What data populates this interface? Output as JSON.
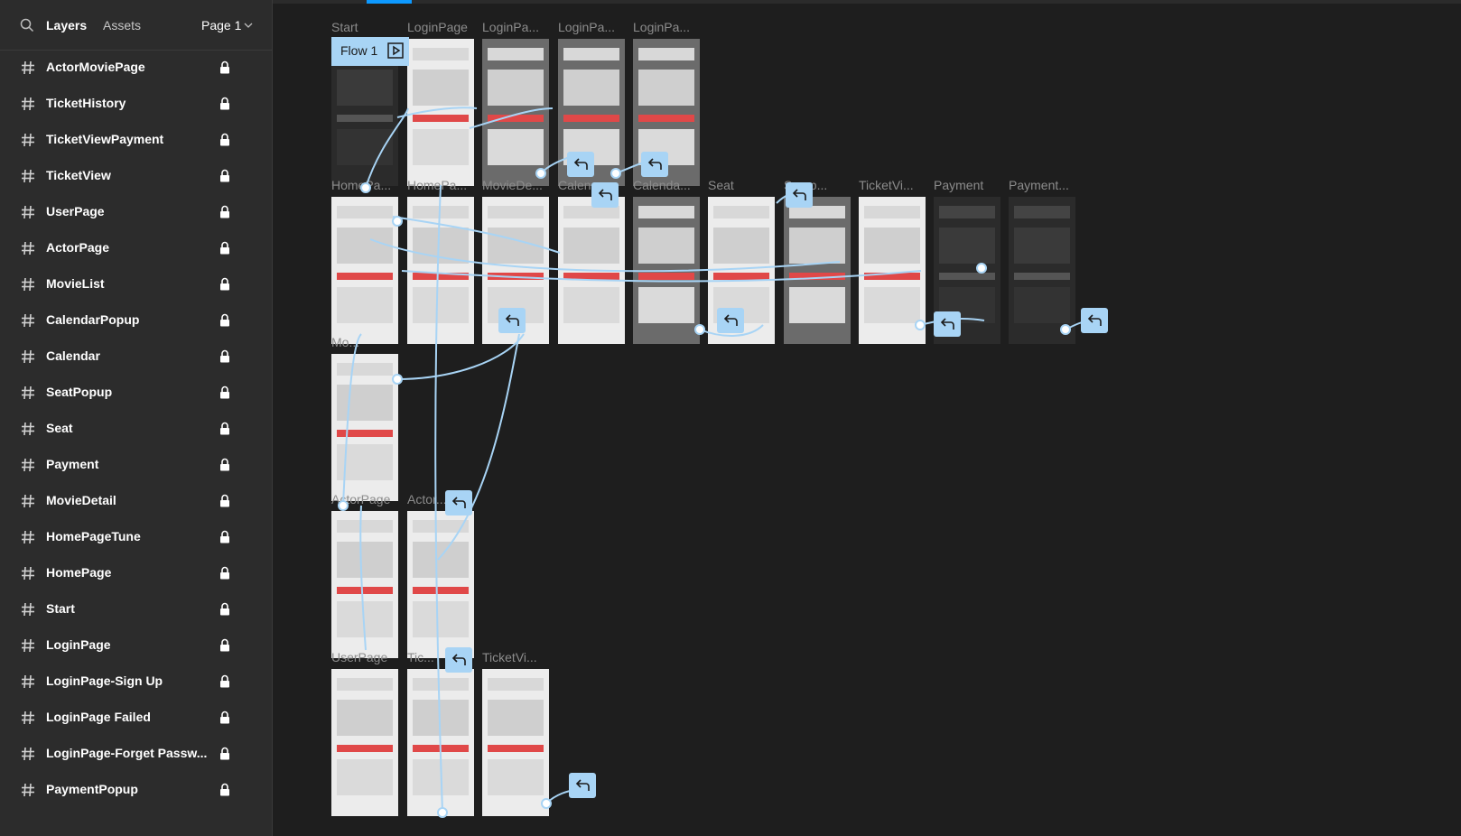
{
  "sidebar": {
    "tabs": {
      "layers": "Layers",
      "assets": "Assets"
    },
    "page_selector": "Page 1",
    "layers": [
      "ActorMoviePage",
      "TicketHistory",
      "TicketViewPayment",
      "TicketView",
      "UserPage",
      "ActorPage",
      "MovieList",
      "CalendarPopup",
      "Calendar",
      "SeatPopup",
      "Seat",
      "Payment",
      "MovieDetail",
      "HomePageTune",
      "HomePage",
      "Start",
      "LoginPage",
      "LoginPage-Sign Up",
      "LoginPage Failed",
      "LoginPage-Forget Passw...",
      "PaymentPopup"
    ]
  },
  "canvas": {
    "flow_badge": "Flow 1",
    "frame_labels": {
      "start": "Start",
      "login1": "LoginPage",
      "login2": "LoginPa...",
      "login3": "LoginPa...",
      "login4": "LoginPa...",
      "homepage": "HomePa...",
      "homepage2": "HomePa...",
      "moviedetail": "MovieDe...",
      "calendar": "Calen...",
      "calendar2": "Calenda...",
      "seat": "Seat",
      "seatpopup": "Se...p...",
      "ticketview": "TicketVi...",
      "payment": "Payment",
      "payment2": "Payment...",
      "movielist": "Mo...",
      "actorpage": "ActorPage",
      "actormovie": "Actor...",
      "userpage": "UserPage",
      "tickethistory": "Tic...",
      "ticketview2": "TicketVi..."
    }
  },
  "colors": {
    "accent": "#a8d4f5",
    "connector": "#a8d4f5",
    "canvas": "#1e1e1e",
    "panel": "#2c2c2c"
  }
}
